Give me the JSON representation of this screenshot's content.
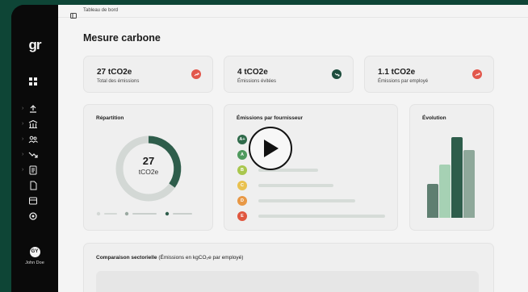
{
  "sidebar": {
    "logo": "gr",
    "user_initials": "GY",
    "user_name": "John Doe"
  },
  "topbar": {
    "breadcrumb": "Tableau de bord"
  },
  "page": {
    "title": "Mesure carbone"
  },
  "stats": [
    {
      "value": "27 tCO2e",
      "label": "Total des émissions",
      "trend": "up",
      "color": "#e2574c"
    },
    {
      "value": "4 tCO2e",
      "label": "Émissions évitées",
      "trend": "down",
      "color": "#1e4d3d"
    },
    {
      "value": "1.1 tCO2e",
      "label": "Émissions par employé",
      "trend": "up",
      "color": "#e2574c"
    }
  ],
  "repartition": {
    "title": "Répartition",
    "value": "27",
    "unit": "tCO2e"
  },
  "fournisseurs": {
    "title": "Émissions par fournisseur",
    "grades": [
      {
        "label": "A+",
        "color": "#2f6a4a",
        "level": 0.1
      },
      {
        "label": "A",
        "color": "#4f9a5e",
        "level": 0.15
      },
      {
        "label": "B",
        "color": "#a9c74e",
        "level": 0.4
      },
      {
        "label": "C",
        "color": "#e9c14f",
        "level": 0.5
      },
      {
        "label": "D",
        "color": "#e89845",
        "level": 0.65
      },
      {
        "label": "E",
        "color": "#e0573f",
        "level": 0.85
      }
    ]
  },
  "evolution": {
    "title": "Évolution",
    "bars": [
      {
        "level": 0.42,
        "color": "#5f7f71"
      },
      {
        "level": 0.66,
        "color": "#a6d1b4"
      },
      {
        "level": 1.0,
        "color": "#2e5d4b"
      },
      {
        "level": 0.84,
        "color": "#8ea89a"
      }
    ]
  },
  "comparaison": {
    "title": "Comparaison sectorielle",
    "subtitle": "(Émissions en kgCO₂e par employé)"
  },
  "colors": {
    "accent": "#1e4d3d",
    "background_outer": "#0e4536",
    "sidebar": "#0a0a0a"
  },
  "icons": [
    "panel-icon",
    "dashboard-icon",
    "upload-icon",
    "bank-icon",
    "team-icon",
    "trend-icon",
    "report-icon",
    "file-icon",
    "box-icon",
    "settings-icon",
    "play-icon"
  ]
}
